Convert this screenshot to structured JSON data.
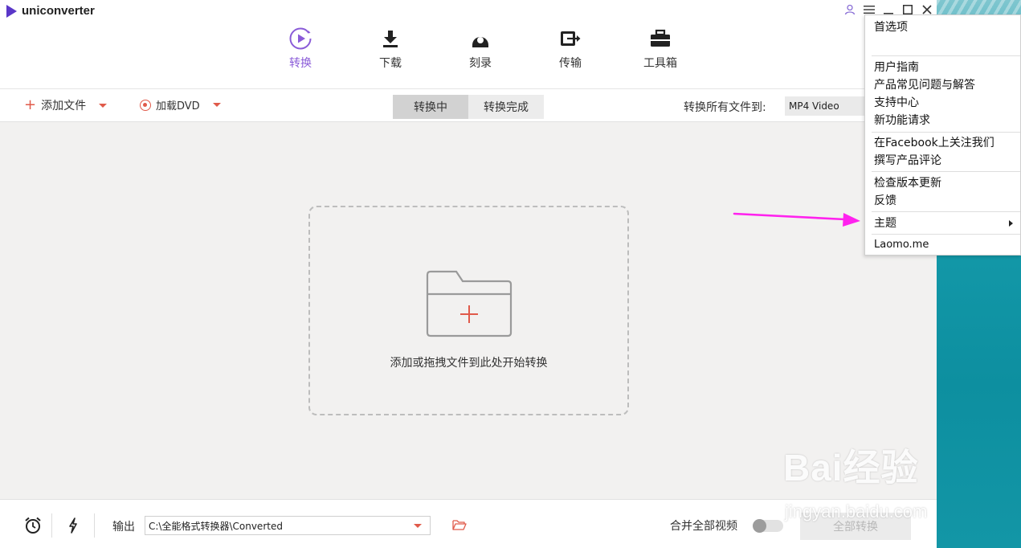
{
  "app": {
    "name": "uniconverter"
  },
  "nav": {
    "tabs": [
      {
        "label": "转换",
        "icon": "convert-icon",
        "active": true
      },
      {
        "label": "下载",
        "icon": "download-icon",
        "active": false
      },
      {
        "label": "刻录",
        "icon": "burn-disc-icon",
        "active": false
      },
      {
        "label": "传输",
        "icon": "transfer-icon",
        "active": false
      },
      {
        "label": "工具箱",
        "icon": "toolbox-icon",
        "active": false
      }
    ]
  },
  "toolbar": {
    "add_files_label": "添加文件",
    "load_dvd_label": "加载DVD",
    "segment": {
      "converting": "转换中",
      "converted": "转换完成"
    },
    "convert_all_to_label": "转换所有文件到:",
    "format_value": "MP4 Video"
  },
  "main": {
    "drop_hint": "添加或拖拽文件到此处开始转换"
  },
  "bottom": {
    "output_label": "输出",
    "output_path": "C:\\全能格式转换器\\Converted",
    "merge_label": "合并全部视频",
    "merge_enabled": false,
    "convert_all_label": "全部转换"
  },
  "menu": {
    "items": [
      "首选项",
      "用户指南",
      "产品常见问题与解答",
      "支持中心",
      "新功能请求",
      "在Facebook上关注我们",
      "撰写产品评论",
      "检查版本更新",
      "反馈",
      "主题",
      "Laomo.me"
    ]
  },
  "watermark": {
    "brand": "Bai经验",
    "url": "jingyan.baidu.com"
  },
  "colors": {
    "accent": "#8a5bd8",
    "red": "#e05a4a",
    "annotation": "#ff22ee"
  }
}
